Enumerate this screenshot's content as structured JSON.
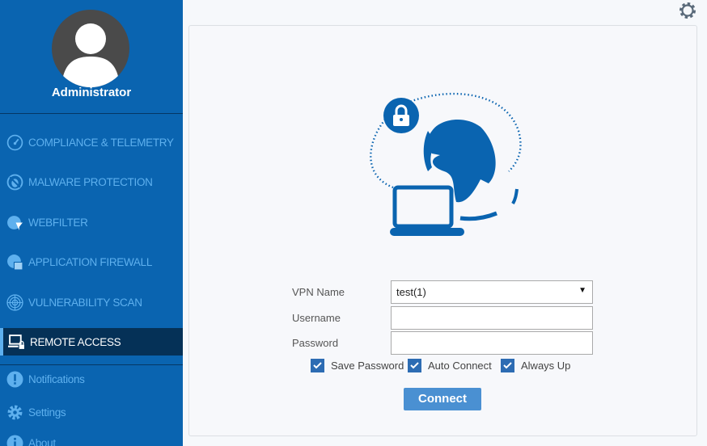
{
  "user": {
    "name": "Administrator"
  },
  "sidebar": {
    "items": [
      {
        "label": "COMPLIANCE & TELEMETRY",
        "icon": "speedometer-icon"
      },
      {
        "label": "MALWARE PROTECTION",
        "icon": "bug-blocked-icon"
      },
      {
        "label": "WEBFILTER",
        "icon": "globe-filter-icon"
      },
      {
        "label": "APPLICATION FIREWALL",
        "icon": "globe-firewall-icon"
      },
      {
        "label": "VULNERABILITY SCAN",
        "icon": "radar-icon"
      },
      {
        "label": "REMOTE ACCESS",
        "icon": "laptop-lock-icon",
        "active": true
      }
    ],
    "bottom": [
      {
        "label": "Notifications",
        "icon": "exclamation-icon"
      },
      {
        "label": "Settings",
        "icon": "gear-icon"
      },
      {
        "label": "About",
        "icon": "info-icon"
      }
    ]
  },
  "form": {
    "vpn_label": "VPN Name",
    "vpn_value": "test(1)",
    "username_label": "Username",
    "username_value": "",
    "password_label": "Password",
    "password_value": "",
    "checkboxes": [
      {
        "label": "Save Password",
        "checked": true
      },
      {
        "label": "Auto Connect",
        "checked": true
      },
      {
        "label": "Always Up",
        "checked": true
      }
    ],
    "connect_label": "Connect"
  },
  "colors": {
    "sidebar": "#0a64b0",
    "active": "#053157",
    "accent": "#4a90d2",
    "nav_text": "#5eb0ee"
  }
}
